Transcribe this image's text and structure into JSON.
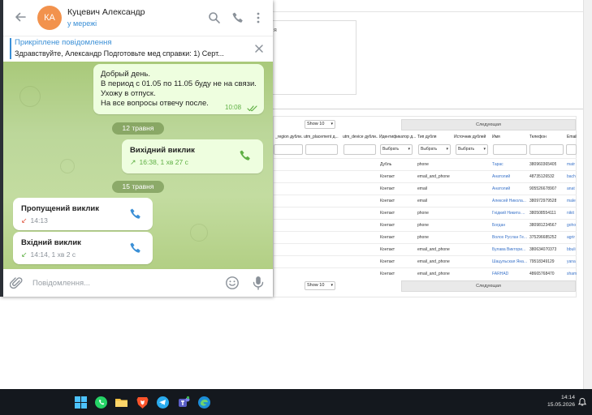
{
  "chat": {
    "avatar_initials": "КА",
    "contact_name": "Куцевич Александр",
    "status": "у мережі",
    "pinned": {
      "title": "Прикріплене повідомлення",
      "text": "Здравствуйте, Александр Подготовьте мед справки: 1) Серт..."
    },
    "messages": [
      {
        "text": "Добрый день.\nВ период с 01.05 по 11.05 буду не на связи.\nУхожу в отпуск.\nНа все вопросы отвечу после.",
        "time": "10:08"
      }
    ],
    "date_separators": [
      "12 травня",
      "15 травня"
    ],
    "calls": [
      {
        "title": "Вихідний виклик",
        "meta": "16:38, 1 хв 27 с",
        "direction": "outgoing"
      },
      {
        "title": "Пропущений виклик",
        "meta": "14:13",
        "direction": "missed"
      },
      {
        "title": "Вхідний виклик",
        "meta": "14:14, 1 хв 2 с",
        "direction": "incoming"
      }
    ],
    "composer_placeholder": "Повідомлення..."
  },
  "background": {
    "card_text": "я",
    "show_label_top": "Show 10",
    "show_label_bottom": "Show 10",
    "next_label_top": "Следующая",
    "next_label_bottom": "Следующая",
    "columns": [
      "_region дубли...",
      "utm_placement д...",
      "utm_device дубли...",
      "Идентификатор д...",
      "Тип дубля",
      "Источник дублей",
      "Имя",
      "Телефон",
      "Email"
    ],
    "filter_select_label": "Выбрать",
    "rows": [
      [
        "Дубль",
        "phone",
        "",
        "Тарас",
        "380960365405",
        "matr"
      ],
      [
        "Контакт",
        "email_and_phone",
        "",
        "Анатолий",
        "48735126532",
        "bach"
      ],
      [
        "Контакт",
        "email",
        "",
        "Анатолий",
        "905526678907",
        "anat"
      ],
      [
        "Контакт",
        "email",
        "",
        "Алексей Никола...",
        "380972979528",
        "male"
      ],
      [
        "Контакт",
        "phone",
        "",
        "Гнідкий Никита ...",
        "380508554111",
        "nikit"
      ],
      [
        "Контакт",
        "phone",
        "",
        "Богдан",
        "380981234567",
        "goho"
      ],
      [
        "Контакт",
        "phone",
        "",
        "Волох Руслан Ге...",
        "375296685252",
        "agrir"
      ],
      [
        "Контакт",
        "email_and_phone",
        "",
        "Булава Виктори...",
        "380634070373",
        "bbuli"
      ],
      [
        "Контакт",
        "email_and_phone",
        "",
        "Шацульская Яна...",
        "79518349129",
        "yana"
      ],
      [
        "Контакт",
        "email_and_phone",
        "",
        "FARHAD",
        "48665768470",
        "sham"
      ]
    ]
  },
  "taskbar": {
    "time": "14:14",
    "date": "15.05.2026"
  },
  "colors": {
    "telegram_blue": "#3a8fd6",
    "outgoing_bubble": "#eefedf",
    "outgoing_accent": "#5fb044",
    "missed_red": "#e0553f",
    "avatar_orange": "#f2924d",
    "taskbar": "#14181e"
  }
}
